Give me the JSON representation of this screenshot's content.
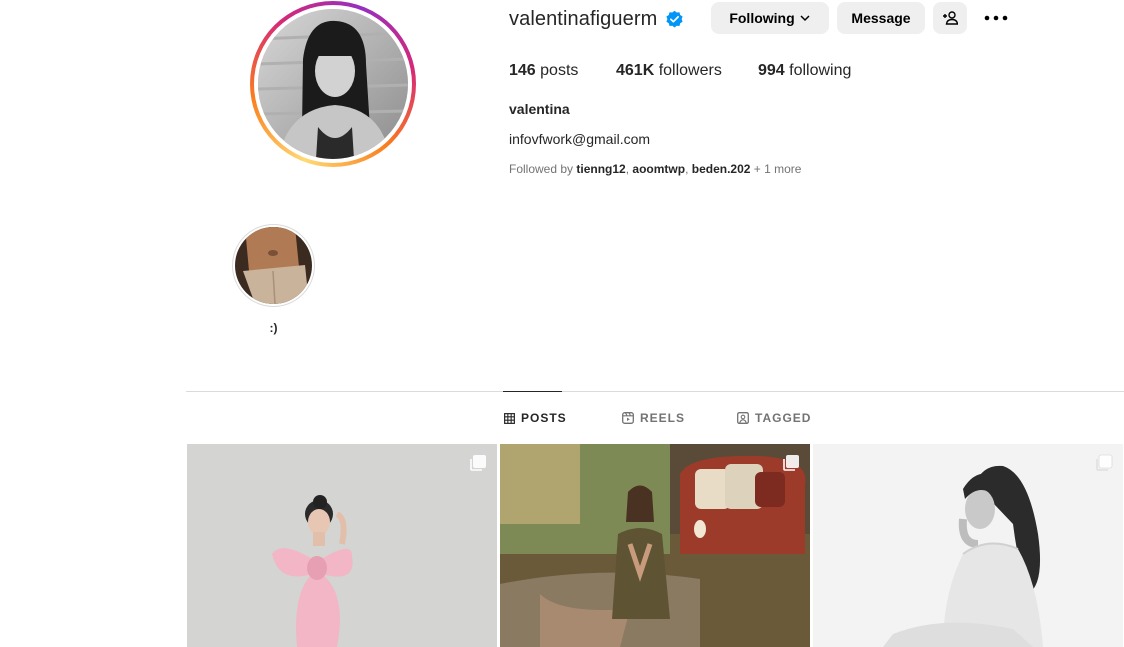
{
  "profile": {
    "username": "valentinafiguerm",
    "verified": true,
    "full_name": "valentina",
    "bio_email": "infovfwork@gmail.com",
    "followed_by_prefix": "Followed by ",
    "followed_by_names": [
      "tienng12",
      "aoomtwp",
      "beden.202"
    ],
    "followed_by_separator": ", ",
    "followed_by_more": " + 1 more"
  },
  "actions": {
    "following_label": "Following",
    "message_label": "Message",
    "add_user_icon": "add-user-icon",
    "more_icon": "more-options-icon"
  },
  "stats": {
    "posts_count": "146",
    "posts_label": " posts",
    "followers_count": "461K",
    "followers_label": " followers",
    "following_count": "994",
    "following_label": " following"
  },
  "highlights": [
    {
      "label": ":)"
    }
  ],
  "tabs": [
    {
      "label": "POSTS",
      "icon": "grid-icon",
      "active": true
    },
    {
      "label": "REELS",
      "icon": "reels-icon",
      "active": false
    },
    {
      "label": "TAGGED",
      "icon": "tagged-icon",
      "active": false
    }
  ],
  "posts": [
    {
      "type": "carousel",
      "icon": "carousel-icon"
    },
    {
      "type": "carousel",
      "icon": "carousel-icon"
    },
    {
      "type": "carousel",
      "icon": "carousel-icon"
    }
  ],
  "colors": {
    "verified_blue": "#0095f6",
    "button_bg": "#efefef",
    "text_primary": "#262626",
    "text_secondary": "#737373",
    "divider": "#dbdbdb"
  }
}
